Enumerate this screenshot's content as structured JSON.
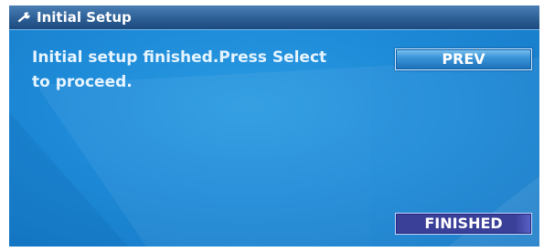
{
  "window": {
    "title": "Initial Setup",
    "title_icon": "wrench-icon"
  },
  "main": {
    "message": "Initial setup finished.Press Select to proceed."
  },
  "buttons": {
    "prev_label": "PREV",
    "finished_label": "FINISHED"
  },
  "colors": {
    "background": "#1f8ad6",
    "titlebar": "#2c5f95",
    "text": "#e6f4ff",
    "finished_button": "#3a3f98",
    "prev_button": "#3b95d8"
  }
}
